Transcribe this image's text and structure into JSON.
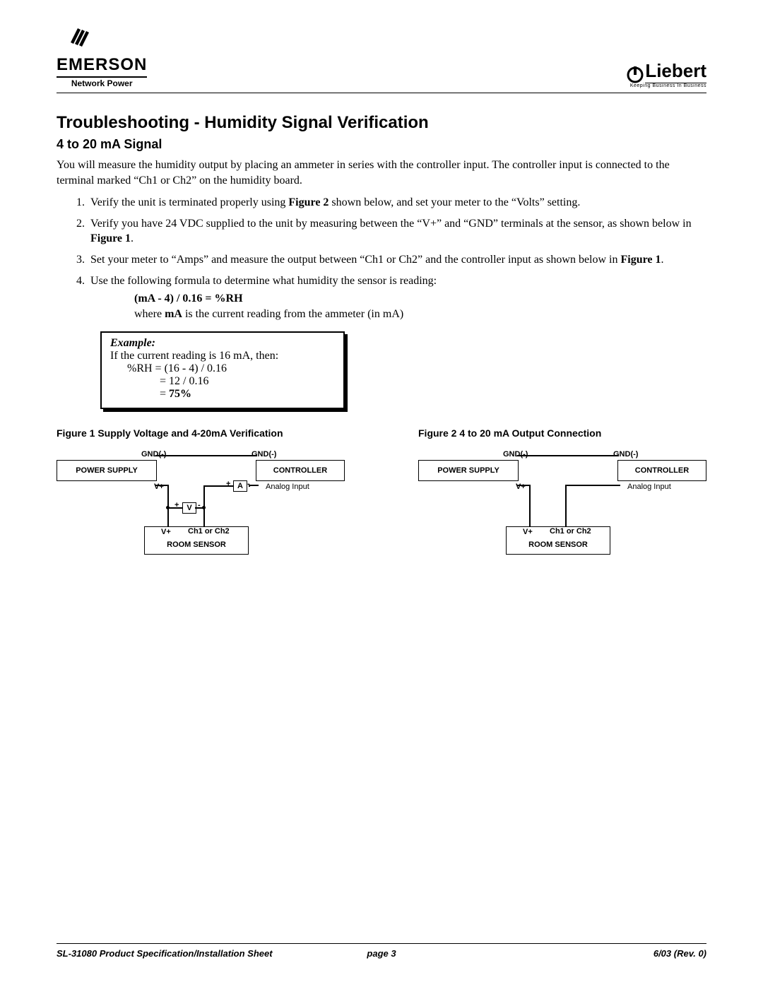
{
  "header": {
    "emerson": "EMERSON",
    "emerson_sub": "Network Power",
    "liebert": "Liebert",
    "liebert_tagline": "Keeping Business In Business"
  },
  "title": "Troubleshooting - Humidity Signal Verification",
  "subtitle": "4 to 20 mA Signal",
  "intro": "You will measure the humidity output by placing an ammeter in series with the controller input. The controller input is connected to the terminal marked “Ch1 or Ch2” on the humidity board.",
  "steps": {
    "s1a": "Verify the unit is terminated properly using ",
    "s1b": "Figure 2",
    "s1c": " shown below, and set your meter to the “Volts” setting.",
    "s2a": "Verify you have 24 VDC supplied to the unit by measuring between the “V+” and “GND” terminals at the sensor, as shown below in ",
    "s2b": "Figure 1",
    "s2c": ".",
    "s3a": "Set your meter to “Amps” and measure the output between “Ch1 or Ch2” and the controller input as shown below in ",
    "s3b": "Figure 1",
    "s3c": ".",
    "s4": "Use the following formula to determine what humidity the sensor is reading:"
  },
  "formula": {
    "eq": "(mA - 4) / 0.16 = %RH",
    "note_a": "where ",
    "note_b": "mA",
    "note_c": " is the current reading from the ammeter (in mA)"
  },
  "example": {
    "title": "Example:",
    "line1": "If the current reading is 16 mA, then:",
    "calc1": "%RH = (16 - 4) / 0.16",
    "calc2": "= 12 / 0.16",
    "calc3_a": "= ",
    "calc3_b": "75%"
  },
  "figures": {
    "f1_caption": "Figure 1  Supply Voltage and 4-20mA Verification",
    "f2_caption": "Figure 2  4 to 20 mA Output Connection",
    "labels": {
      "power_supply": "POWER SUPPLY",
      "controller": "CONTROLLER",
      "analog_input": "Analog Input",
      "room_sensor": "ROOM SENSOR",
      "gnd": "GND(-)",
      "vplus": "V+",
      "ch": "Ch1 or Ch2",
      "plus": "+",
      "minus": "-",
      "A": "A",
      "V": "V"
    }
  },
  "footer": {
    "left": "SL-31080 Product Specification/Installation Sheet",
    "center": "page 3",
    "right": "6/03 (Rev. 0)"
  }
}
